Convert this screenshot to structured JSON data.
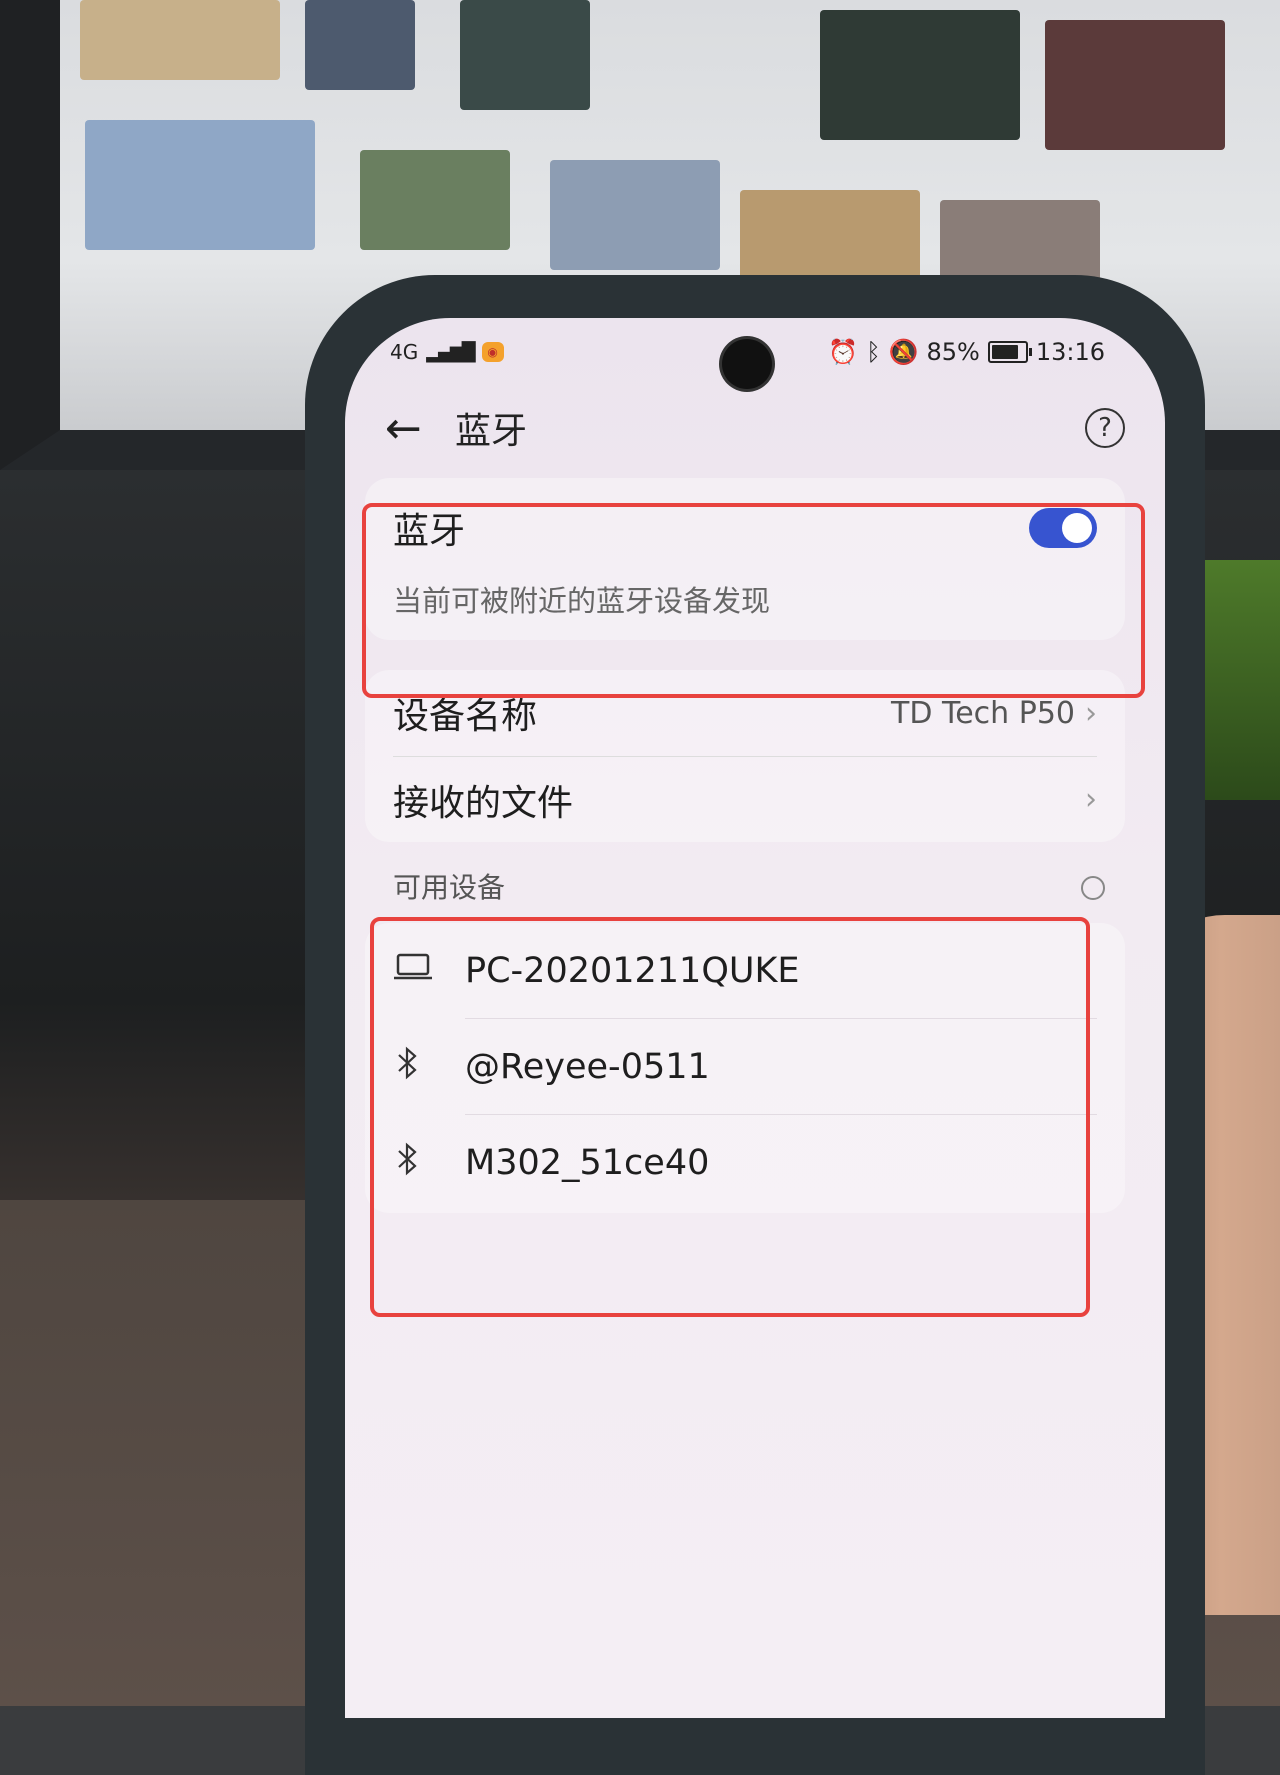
{
  "status_bar": {
    "signal": "4G",
    "battery": "85%",
    "time": "13:16"
  },
  "appbar": {
    "title": "蓝牙",
    "help": "?"
  },
  "bluetooth_toggle": {
    "label": "蓝牙",
    "enabled": true,
    "description": "当前可被附近的蓝牙设备发现"
  },
  "device_settings": {
    "device_name_label": "设备名称",
    "device_name_value": "TD Tech P50",
    "received_files_label": "接收的文件"
  },
  "available_devices": {
    "section_label": "可用设备",
    "items": [
      {
        "icon": "laptop-icon",
        "name": "PC-20201211QUKE"
      },
      {
        "icon": "bluetooth-icon",
        "name": "@Reyee-0511"
      },
      {
        "icon": "bluetooth-icon",
        "name": "M302_51ce40"
      }
    ]
  },
  "colors": {
    "toggle_on": "#3754d0",
    "highlight_box": "#e8423e"
  }
}
